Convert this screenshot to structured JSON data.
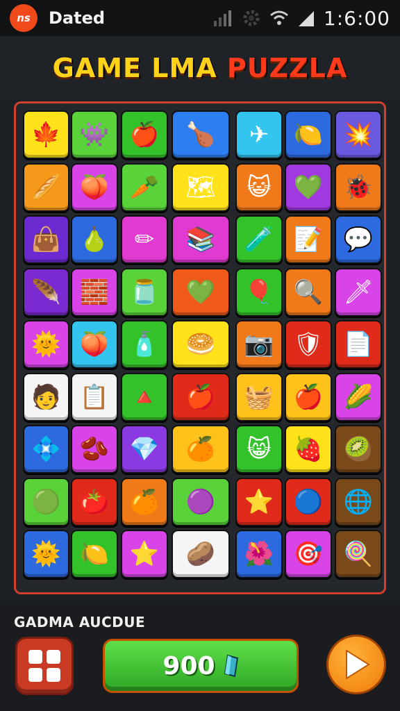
{
  "status_bar": {
    "app_icon_text": "ns",
    "app_name": "Dated",
    "clock": "1:6:00",
    "icons": [
      "signal-icon",
      "settings-icon",
      "wifi-icon",
      "signal-strength-icon"
    ]
  },
  "title": {
    "part1": "GAME LMA ",
    "part2": "PUZZLA"
  },
  "board": {
    "rows": 9,
    "cols": 7,
    "tiles": [
      {
        "color": "#ffe21a",
        "icon": "leaf-icon",
        "glyph": "🍁"
      },
      {
        "color": "#5ad33a",
        "icon": "monster-icon",
        "glyph": "👾"
      },
      {
        "color": "#33c22a",
        "icon": "apple-icon",
        "glyph": "🍎"
      },
      {
        "color": "#2d7ef0",
        "icon": "drumstick-icon",
        "glyph": "🍗"
      },
      {
        "color": "#33c4f0",
        "icon": "paper-plane-icon",
        "glyph": "✈"
      },
      {
        "color": "#2d6ae0",
        "icon": "lemon-icon",
        "glyph": "🍋"
      },
      {
        "color": "#6a5ae0",
        "icon": "splash-icon",
        "glyph": "💥"
      },
      {
        "color": "#f59a1a",
        "icon": "bread-icon",
        "glyph": "🥖"
      },
      {
        "color": "#d844e8",
        "icon": "peach-icon",
        "glyph": "🍑"
      },
      {
        "color": "#5ad33a",
        "icon": "carrot-icon",
        "glyph": "🥕"
      },
      {
        "color": "#ffe21a",
        "icon": "map-icon",
        "glyph": "🗺"
      },
      {
        "color": "#f07a1a",
        "icon": "cat-face-icon",
        "glyph": "😺"
      },
      {
        "color": "#a03ae0",
        "icon": "heart-face-icon",
        "glyph": "💚"
      },
      {
        "color": "#f07a1a",
        "icon": "bug-icon",
        "glyph": "🐞"
      },
      {
        "color": "#6a2ad0",
        "icon": "bag-icon",
        "glyph": "👜"
      },
      {
        "color": "#2d6ae0",
        "icon": "pear-icon",
        "glyph": "🍐"
      },
      {
        "color": "#e03ad0",
        "icon": "pencil-icon",
        "glyph": "✏"
      },
      {
        "color": "#e03ad0",
        "icon": "books-icon",
        "glyph": "📚"
      },
      {
        "color": "#33c22a",
        "icon": "bottles-icon",
        "glyph": "🧪"
      },
      {
        "color": "#f07a1a",
        "icon": "notepad-icon",
        "glyph": "📝"
      },
      {
        "color": "#2d6ae0",
        "icon": "chat-bubble-icon",
        "glyph": "💬"
      },
      {
        "color": "#7a2ad0",
        "icon": "feather-icon",
        "glyph": "🪶"
      },
      {
        "color": "#d844e8",
        "icon": "bricks-icon",
        "glyph": "🧱"
      },
      {
        "color": "#5ad33a",
        "icon": "jar-icon",
        "glyph": "🫙"
      },
      {
        "color": "#f05a1a",
        "icon": "heart-icon",
        "glyph": "💚"
      },
      {
        "color": "#33c22a",
        "icon": "balloon-icon",
        "glyph": "🎈"
      },
      {
        "color": "#f07a1a",
        "icon": "magnifier-icon",
        "glyph": "🔍"
      },
      {
        "color": "#d844e8",
        "icon": "sword-icon",
        "glyph": "🗡"
      },
      {
        "color": "#d844e8",
        "icon": "sun-icon",
        "glyph": "🌞"
      },
      {
        "color": "#33c4f0",
        "icon": "peach-icon",
        "glyph": "🍑"
      },
      {
        "color": "#33c22a",
        "icon": "potion-icon",
        "glyph": "🧴"
      },
      {
        "color": "#ffe21a",
        "icon": "bread-icon",
        "glyph": "🥯"
      },
      {
        "color": "#f07a1a",
        "icon": "camera-icon",
        "glyph": "📷"
      },
      {
        "color": "#e02a1a",
        "icon": "shield-icon",
        "glyph": "🛡"
      },
      {
        "color": "#e02a1a",
        "icon": "document-icon",
        "glyph": "📄"
      },
      {
        "color": "#f5f5f5",
        "icon": "face-icon",
        "glyph": "🧑"
      },
      {
        "color": "#f5f5f5",
        "icon": "clipboard-icon",
        "glyph": "📋"
      },
      {
        "color": "#33c22a",
        "icon": "cone-icon",
        "glyph": "🔺"
      },
      {
        "color": "#e02a1a",
        "icon": "heart-apple-icon",
        "glyph": "🍎"
      },
      {
        "color": "#ffc21a",
        "icon": "basket-icon",
        "glyph": "🧺"
      },
      {
        "color": "#ffc21a",
        "icon": "apple-icon",
        "glyph": "🍎"
      },
      {
        "color": "#d844e8",
        "icon": "corn-icon",
        "glyph": "🌽"
      },
      {
        "color": "#2d6ae0",
        "icon": "gem-icon",
        "glyph": "💠"
      },
      {
        "color": "#d844e8",
        "icon": "bean-icon",
        "glyph": "🫘"
      },
      {
        "color": "#8a3ae0",
        "icon": "crystal-icon",
        "glyph": "💎"
      },
      {
        "color": "#ffc21a",
        "icon": "orange-face-icon",
        "glyph": "🍊"
      },
      {
        "color": "#33c22a",
        "icon": "cat-face-icon",
        "glyph": "😸"
      },
      {
        "color": "#ffe21a",
        "icon": "strawberry-icon",
        "glyph": "🍓"
      },
      {
        "color": "#7a4a1a",
        "icon": "lime-icon",
        "glyph": "🥝"
      },
      {
        "color": "#5ad33a",
        "icon": "slime-icon",
        "glyph": "🟢"
      },
      {
        "color": "#e02a1a",
        "icon": "tomato-icon",
        "glyph": "🍅"
      },
      {
        "color": "#f07a1a",
        "icon": "orange-icon",
        "glyph": "🍊"
      },
      {
        "color": "#5ad33a",
        "icon": "blob-icon",
        "glyph": "🟣"
      },
      {
        "color": "#e02a1a",
        "icon": "star-icon",
        "glyph": "⭐"
      },
      {
        "color": "#e02a1a",
        "icon": "blue-blob-icon",
        "glyph": "🔵"
      },
      {
        "color": "#7a4a1a",
        "icon": "globe-icon",
        "glyph": "🌐"
      },
      {
        "color": "#2d6ae0",
        "icon": "sun-face-icon",
        "glyph": "🌞"
      },
      {
        "color": "#33c22a",
        "icon": "lemon-icon",
        "glyph": "🍋"
      },
      {
        "color": "#d844e8",
        "icon": "starfish-icon",
        "glyph": "⭐"
      },
      {
        "color": "#f5f5f5",
        "icon": "bean-icon",
        "glyph": "🥔"
      },
      {
        "color": "#2d6ae0",
        "icon": "flower-icon",
        "glyph": "🌺"
      },
      {
        "color": "#d844e8",
        "icon": "target-icon",
        "glyph": "🎯"
      },
      {
        "color": "#7a4a1a",
        "icon": "lollipop-icon",
        "glyph": "🍭"
      }
    ]
  },
  "bottom": {
    "label": "GADMA AUCDUE",
    "score": "900",
    "menu_icon": "grid-menu-icon",
    "play_icon": "play-icon"
  }
}
